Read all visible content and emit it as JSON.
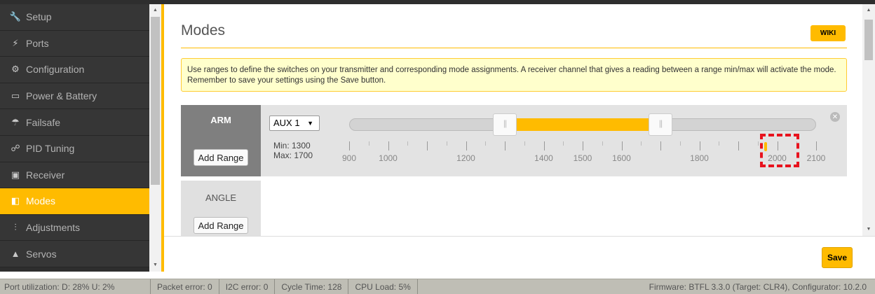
{
  "sidebar": {
    "items": [
      {
        "label": "Setup",
        "icon": "wrench-icon",
        "glyph": "🔧",
        "active": false
      },
      {
        "label": "Ports",
        "icon": "plug-icon",
        "glyph": "⚡",
        "active": false
      },
      {
        "label": "Configuration",
        "icon": "gear-icon",
        "glyph": "⚙",
        "active": false
      },
      {
        "label": "Power & Battery",
        "icon": "battery-icon",
        "glyph": "▭",
        "active": false
      },
      {
        "label": "Failsafe",
        "icon": "parachute-icon",
        "glyph": "☂",
        "active": false
      },
      {
        "label": "PID Tuning",
        "icon": "sitemap-icon",
        "glyph": "☍",
        "active": false
      },
      {
        "label": "Receiver",
        "icon": "remote-icon",
        "glyph": "▣",
        "active": false
      },
      {
        "label": "Modes",
        "icon": "toggle-icon",
        "glyph": "◧",
        "active": true
      },
      {
        "label": "Adjustments",
        "icon": "sliders-icon",
        "glyph": "⫶",
        "active": false
      },
      {
        "label": "Servos",
        "icon": "servo-icon",
        "glyph": "▲",
        "active": false
      }
    ]
  },
  "main": {
    "title": "Modes",
    "wiki_label": "WIKI",
    "note": "Use ranges to define the switches on your transmitter and corresponding mode assignments. A receiver channel that gives a reading between a range min/max will activate the mode. Remember to save your settings using the Save button.",
    "modes": [
      {
        "name": "ARM",
        "add_range_label": "Add Range",
        "channel": "AUX 1",
        "min_label": "Min: 1300",
        "max_label": "Max: 1700",
        "range_min": 1300,
        "range_max": 1700,
        "live_value": 1970,
        "remove_glyph": "✕"
      },
      {
        "name": "ANGLE",
        "add_range_label": "Add Range"
      }
    ],
    "scale": {
      "min": 900,
      "max": 2100,
      "labels": [
        "900",
        "1000",
        "1200",
        "1400",
        "1500",
        "1600",
        "1800",
        "2000",
        "2100"
      ]
    },
    "save_label": "Save"
  },
  "status": {
    "port_util": "Port utilization: D: 28% U: 2%",
    "packet_error": "Packet error: 0",
    "i2c_error": "I2C error: 0",
    "cycle_time": "Cycle Time: 128",
    "cpu_load": "CPU Load: 5%",
    "firmware": "Firmware: BTFL 3.3.0 (Target: CLR4), Configurator: 10.2.0"
  },
  "colors": {
    "accent": "#ffbb00",
    "sidebar_bg": "#2e2e2e",
    "highlight": "#e8131e"
  }
}
